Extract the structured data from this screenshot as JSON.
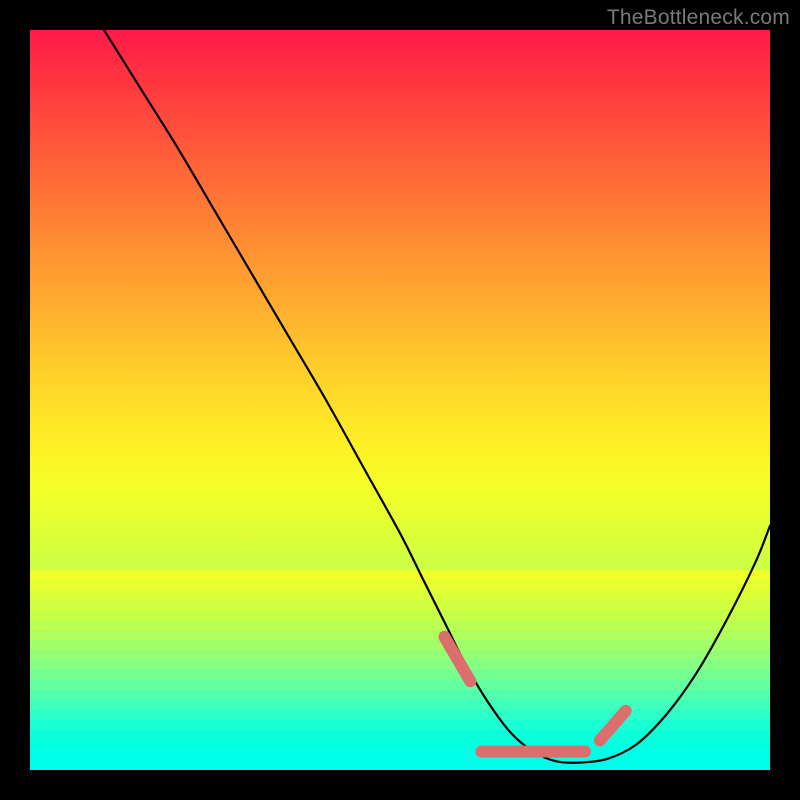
{
  "watermark": "TheBottleneck.com",
  "colors": {
    "frame": "#000000",
    "curve": "#000000",
    "highlight": "#dd6e6e",
    "gradient_top": "#ff1a49",
    "gradient_bottom": "#10ffd0"
  },
  "chart_data": {
    "type": "line",
    "title": "",
    "xlabel": "",
    "ylabel": "",
    "xlim": [
      0,
      100
    ],
    "ylim": [
      0,
      100
    ],
    "grid": false,
    "legend": false,
    "annotations": [],
    "series": [
      {
        "name": "bottleneck-curve",
        "x": [
          10,
          15,
          20,
          25,
          30,
          35,
          40,
          45,
          50,
          53,
          56,
          59,
          62,
          65,
          68,
          71,
          74,
          78,
          82,
          86,
          90,
          94,
          98,
          100
        ],
        "y": [
          100,
          92,
          84,
          75.5,
          67,
          58.5,
          50,
          41,
          32,
          26,
          20,
          14,
          9,
          5,
          2.5,
          1.2,
          1,
          1.5,
          3.5,
          7.5,
          13,
          20,
          28,
          33
        ]
      }
    ],
    "highlight_segments": [
      {
        "x": [
          56,
          59.5
        ],
        "y": [
          18,
          12
        ]
      },
      {
        "x": [
          61,
          75
        ],
        "y": [
          2.5,
          2.5
        ]
      },
      {
        "x": [
          77,
          80.5
        ],
        "y": [
          4,
          8
        ]
      }
    ]
  }
}
